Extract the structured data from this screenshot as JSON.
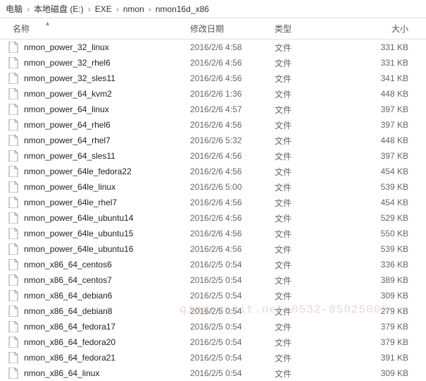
{
  "breadcrumb": {
    "items": [
      "电脑",
      "本地磁盘 (E:)",
      "EXE",
      "nmon",
      "nmon16d_x86"
    ]
  },
  "columns": {
    "name": "名称",
    "date": "修改日期",
    "type": "类型",
    "size": "大小"
  },
  "file_type_label": "文件",
  "watermark": "qingruanit.net 0532-85025005",
  "files": [
    {
      "name": "nmon_power_32_linux",
      "date": "2016/2/6 4:58",
      "size": "331 KB"
    },
    {
      "name": "nmon_power_32_rhel6",
      "date": "2016/2/6 4:56",
      "size": "331 KB"
    },
    {
      "name": "nmon_power_32_sles11",
      "date": "2016/2/6 4:56",
      "size": "341 KB"
    },
    {
      "name": "nmon_power_64_kvm2",
      "date": "2016/2/6 1:36",
      "size": "448 KB"
    },
    {
      "name": "nmon_power_64_linux",
      "date": "2016/2/6 4:57",
      "size": "397 KB"
    },
    {
      "name": "nmon_power_64_rhel6",
      "date": "2016/2/6 4:56",
      "size": "397 KB"
    },
    {
      "name": "nmon_power_64_rhel7",
      "date": "2016/2/6 5:32",
      "size": "448 KB"
    },
    {
      "name": "nmon_power_64_sles11",
      "date": "2016/2/6 4:56",
      "size": "397 KB"
    },
    {
      "name": "nmon_power_64le_fedora22",
      "date": "2016/2/6 4:56",
      "size": "454 KB"
    },
    {
      "name": "nmon_power_64le_linux",
      "date": "2016/2/6 5:00",
      "size": "539 KB"
    },
    {
      "name": "nmon_power_64le_rhel7",
      "date": "2016/2/6 4:56",
      "size": "454 KB"
    },
    {
      "name": "nmon_power_64le_ubuntu14",
      "date": "2016/2/6 4:56",
      "size": "529 KB"
    },
    {
      "name": "nmon_power_64le_ubuntu15",
      "date": "2016/2/6 4:56",
      "size": "550 KB"
    },
    {
      "name": "nmon_power_64le_ubuntu16",
      "date": "2016/2/6 4:56",
      "size": "539 KB"
    },
    {
      "name": "nmon_x86_64_centos6",
      "date": "2016/2/5 0:54",
      "size": "336 KB"
    },
    {
      "name": "nmon_x86_64_centos7",
      "date": "2016/2/5 0:54",
      "size": "389 KB"
    },
    {
      "name": "nmon_x86_64_debian6",
      "date": "2016/2/5 0:54",
      "size": "309 KB"
    },
    {
      "name": "nmon_x86_64_debian8",
      "date": "2016/2/5 0:54",
      "size": "279 KB"
    },
    {
      "name": "nmon_x86_64_fedora17",
      "date": "2016/2/5 0:54",
      "size": "379 KB"
    },
    {
      "name": "nmon_x86_64_fedora20",
      "date": "2016/2/5 0:54",
      "size": "379 KB"
    },
    {
      "name": "nmon_x86_64_fedora21",
      "date": "2016/2/5 0:54",
      "size": "391 KB"
    },
    {
      "name": "nmon_x86_64_linux",
      "date": "2016/2/5 0:54",
      "size": "309 KB"
    }
  ]
}
